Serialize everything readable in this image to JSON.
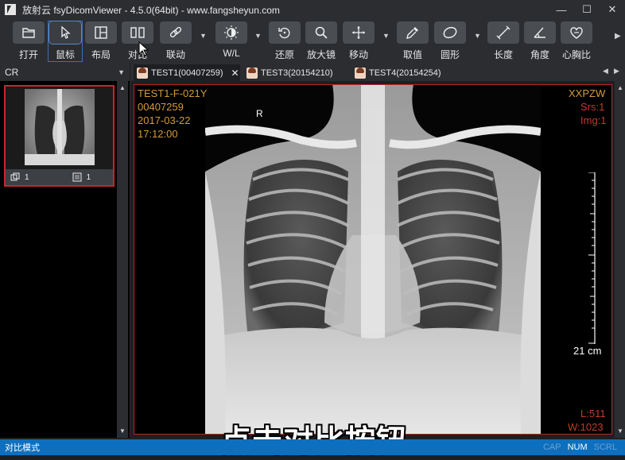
{
  "window": {
    "title": "放射云 fsyDicomViewer - 4.5.0(64bit) - www.fangsheyun.com",
    "controls": {
      "minimize": "—",
      "maximize": "☐",
      "close": "✕"
    }
  },
  "toolbar": {
    "tools": [
      {
        "label": "打开",
        "icon": "folder-open-icon"
      },
      {
        "label": "鼠标",
        "icon": "mouse-pointer-icon"
      },
      {
        "label": "布局",
        "icon": "layout-icon"
      },
      {
        "label": "对比",
        "icon": "compare-icon"
      },
      {
        "label": "联动",
        "icon": "link-icon"
      },
      {
        "label": "W/L",
        "icon": "brightness-icon"
      },
      {
        "label": "还原",
        "icon": "reset-icon"
      },
      {
        "label": "放大镜",
        "icon": "magnifier-icon"
      },
      {
        "label": "移动",
        "icon": "move-icon"
      },
      {
        "label": "取值",
        "icon": "eyedropper-icon"
      },
      {
        "label": "圆形",
        "icon": "ellipse-icon"
      },
      {
        "label": "长度",
        "icon": "ruler-line-icon"
      },
      {
        "label": "角度",
        "icon": "angle-icon"
      },
      {
        "label": "心胸比",
        "icon": "heart-chest-icon"
      }
    ]
  },
  "sidebar": {
    "modality": "CR",
    "thumbnail": {
      "series_count": "1",
      "image_count": "1"
    }
  },
  "tabs": [
    {
      "label": "TEST1(00407259)",
      "active": true,
      "close": "✕"
    },
    {
      "label": "TEST3(20154210)",
      "active": false
    },
    {
      "label": "TEST4(20154254)",
      "active": false
    }
  ],
  "viewer": {
    "top_left": [
      "TEST1-F-021Y",
      "00407259",
      "2017-03-22",
      "17:12:00"
    ],
    "orientation_marker": "R",
    "top_right": {
      "institution": "XXPZW",
      "series": "Srs:1",
      "image": "Img:1"
    },
    "scale_label": "21 cm",
    "bottom_right": {
      "level": "L:511",
      "width": "W:1023"
    }
  },
  "caption": "点击对比按钮",
  "status": {
    "mode": "对比模式",
    "keys": [
      {
        "label": "CAP",
        "on": false
      },
      {
        "label": "NUM",
        "on": true
      },
      {
        "label": "SCRL",
        "on": false
      }
    ]
  },
  "colors": {
    "accent_red": "#c8262e",
    "overlay_text": "#d49a38",
    "status_bar": "#0d6fbf"
  }
}
